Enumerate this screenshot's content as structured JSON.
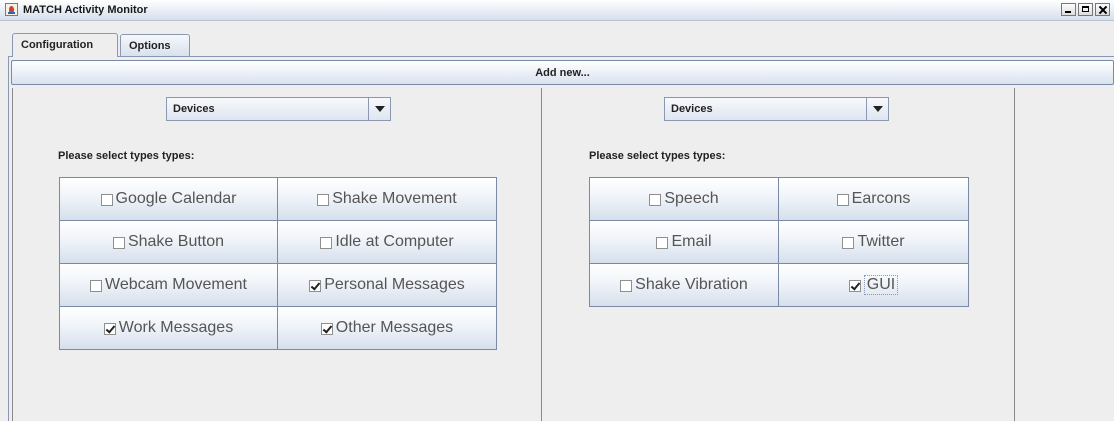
{
  "window": {
    "title": "MATCH Activity Monitor",
    "app_icon": "java-icon",
    "controls": [
      "minimize-icon",
      "maximize-icon",
      "close-icon"
    ]
  },
  "tabs": [
    {
      "label": "Configuration",
      "selected": true
    },
    {
      "label": "Options",
      "selected": false
    }
  ],
  "add_new_label": "Add new...",
  "left_panel": {
    "dropdown_value": "Devices",
    "prompt": "Please select types types:",
    "options": [
      {
        "label": "Google Calendar",
        "checked": false
      },
      {
        "label": "Shake Movement",
        "checked": false
      },
      {
        "label": "Shake Button",
        "checked": false
      },
      {
        "label": "Idle at Computer",
        "checked": false
      },
      {
        "label": "Webcam Movement",
        "checked": false
      },
      {
        "label": "Personal Messages",
        "checked": true
      },
      {
        "label": "Work Messages",
        "checked": true
      },
      {
        "label": "Other Messages",
        "checked": true
      }
    ]
  },
  "right_panel": {
    "dropdown_value": "Devices",
    "prompt": "Please select types types:",
    "options": [
      {
        "label": "Speech",
        "checked": false
      },
      {
        "label": "Earcons",
        "checked": false
      },
      {
        "label": "Email",
        "checked": false
      },
      {
        "label": "Twitter",
        "checked": false
      },
      {
        "label": "Shake Vibration",
        "checked": false
      },
      {
        "label": "GUI",
        "checked": true,
        "focused": true
      }
    ]
  }
}
